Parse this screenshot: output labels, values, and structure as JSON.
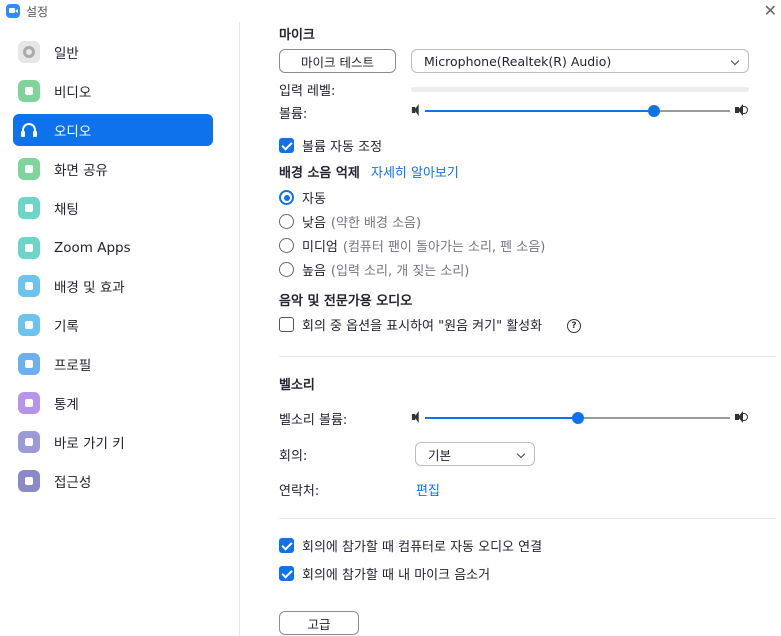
{
  "window": {
    "title": "설정"
  },
  "sidebar": {
    "items": [
      {
        "label": "일반",
        "icon": "gear-icon",
        "color": "#E6E6E6"
      },
      {
        "label": "비디오",
        "icon": "video-camera-icon",
        "color": "#7ED49A"
      },
      {
        "label": "오디오",
        "icon": "headphones-icon",
        "color": "#0E72ED",
        "active": true
      },
      {
        "label": "화면 공유",
        "icon": "share-screen-icon",
        "color": "#7ED49A"
      },
      {
        "label": "채팅",
        "icon": "chat-bubble-icon",
        "color": "#6DD4C8"
      },
      {
        "label": "Zoom Apps",
        "icon": "apps-icon",
        "color": "#6DD4C8"
      },
      {
        "label": "배경 및 효과",
        "icon": "background-person-icon",
        "color": "#6DC3EE"
      },
      {
        "label": "기록",
        "icon": "record-icon",
        "color": "#6DC3EE"
      },
      {
        "label": "프로필",
        "icon": "profile-icon",
        "color": "#6DB0EE"
      },
      {
        "label": "통계",
        "icon": "statistics-icon",
        "color": "#B694E8"
      },
      {
        "label": "바로 가기 키",
        "icon": "keyboard-icon",
        "color": "#9A9AD8"
      },
      {
        "label": "접근성",
        "icon": "accessibility-icon",
        "color": "#8A8AC8"
      }
    ]
  },
  "mic": {
    "section_title": "마이크",
    "test_button": "마이크 테스트",
    "device_selected": "Microphone(Realtek(R) Audio)",
    "input_level_label": "입력 레벨:",
    "volume_label": "볼륨:",
    "volume_level": 0.75,
    "auto_adjust_label": "볼륨 자동 조정",
    "auto_adjust_checked": true
  },
  "noise": {
    "title": "배경 소음 억제",
    "learn_more": "자세히 알아보기",
    "options": [
      {
        "label": "자동",
        "sub": "",
        "selected": true
      },
      {
        "label": "낮음",
        "sub": "(약한 배경 소음)",
        "selected": false
      },
      {
        "label": "미디엄",
        "sub": "(컴퓨터 팬이 돌아가는 소리, 펜 소음)",
        "selected": false
      },
      {
        "label": "높음",
        "sub": "(입력 소리, 개 짖는 소리)",
        "selected": false
      }
    ]
  },
  "music": {
    "title": "음악 및 전문가용 오디오",
    "original_sound_label": "회의 중 옵션을 표시하여 \"원음 켜기\" 활성화",
    "original_sound_checked": false,
    "help_glyph": "?"
  },
  "ringtone": {
    "title": "벨소리",
    "volume_label": "벨소리 볼륨:",
    "volume_level": 0.5,
    "meeting_label": "회의:",
    "meeting_selected": "기본",
    "contacts_label": "연락처:",
    "contacts_link": "편집"
  },
  "join": {
    "auto_connect_label": "회의에 참가할 때 컴퓨터로 자동 오디오 연결",
    "auto_connect_checked": true,
    "mute_label": "회의에 참가할 때 내 마이크 음소거",
    "mute_checked": true
  },
  "advanced_button": "고급"
}
